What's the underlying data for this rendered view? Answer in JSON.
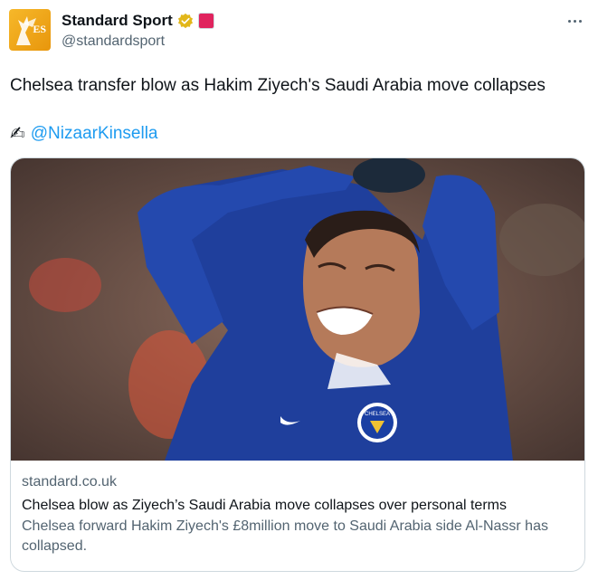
{
  "account": {
    "display_name": "Standard Sport",
    "handle": "@standardsport",
    "avatar_text": "ES"
  },
  "tweet": {
    "text": "Chelsea transfer blow as Hakim Ziyech's Saudi Arabia move collapses",
    "mention": "@NizaarKinsella",
    "credit_icon": "✍"
  },
  "link_card": {
    "domain": "standard.co.uk",
    "title": "Chelsea blow as Ziyech’s Saudi Arabia move collapses over personal terms",
    "description": "Chelsea forward Hakim Ziyech's £8million move to Saudi Arabia side Al-Nassr has collapsed.",
    "image_badge": "CHELSEA"
  },
  "colors": {
    "link_blue": "#1d9bf0",
    "secondary_text": "#536471",
    "verified_gold": "#e2b719",
    "chelsea_blue": "#1a3fa3"
  },
  "icons": [
    "verified-badge-icon",
    "affiliate-badge-icon",
    "more-options-icon",
    "writing-hand-icon"
  ]
}
